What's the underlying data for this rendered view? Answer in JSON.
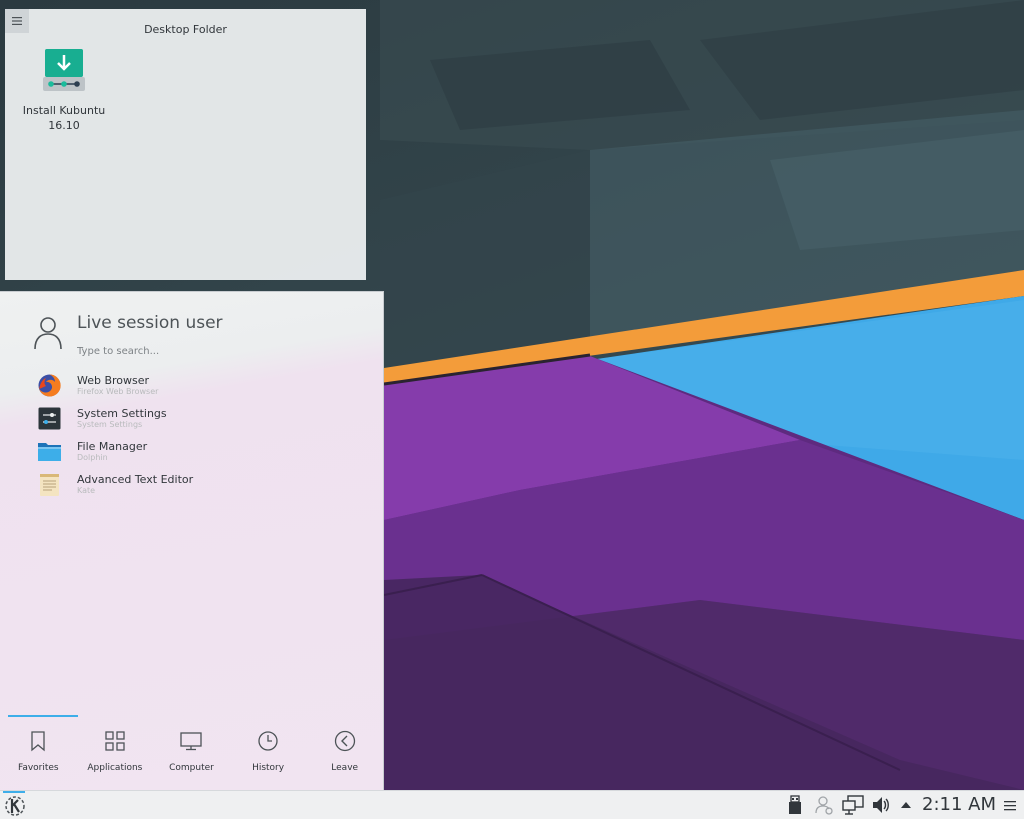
{
  "desktop_folder": {
    "title": "Desktop Folder",
    "icons": [
      {
        "label": "Install Kubuntu\n16.10",
        "icon": "installer-icon"
      }
    ]
  },
  "launcher": {
    "user_name": "Live session user",
    "search_placeholder": "Type to search...",
    "favorites": [
      {
        "name": "Web Browser",
        "subtitle": "Firefox Web Browser",
        "icon": "firefox-icon"
      },
      {
        "name": "System Settings",
        "subtitle": "System Settings",
        "icon": "system-settings-icon"
      },
      {
        "name": "File Manager",
        "subtitle": "Dolphin",
        "icon": "folder-icon"
      },
      {
        "name": "Advanced Text Editor",
        "subtitle": "Kate",
        "icon": "text-editor-icon"
      }
    ],
    "tabs": [
      {
        "label": "Favorites",
        "icon": "bookmark-icon",
        "active": true
      },
      {
        "label": "Applications",
        "icon": "grid-icon"
      },
      {
        "label": "Computer",
        "icon": "monitor-icon"
      },
      {
        "label": "History",
        "icon": "clock-icon"
      },
      {
        "label": "Leave",
        "icon": "back-arrow-icon"
      }
    ]
  },
  "panel": {
    "clock": "2:11 AM",
    "tray_icons": [
      "usb-icon",
      "user-switch-icon",
      "network-icon",
      "volume-icon",
      "expand-arrow-icon",
      "panel-menu-icon"
    ]
  },
  "colors": {
    "accent": "#3daee9",
    "wallpaper_purple": "#6a2f8e",
    "wallpaper_blue": "#3fa9e8",
    "wallpaper_orange": "#f39c3a"
  }
}
